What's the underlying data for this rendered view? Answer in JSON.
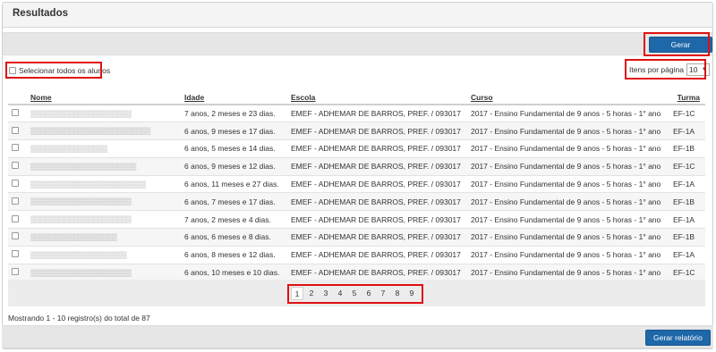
{
  "title": "Resultados",
  "actions": {
    "generate_report": "Gerar relatório"
  },
  "select_all_label": "Selecionar todos os alunos",
  "per_page": {
    "label": "Itens por página",
    "value": "10"
  },
  "table": {
    "headers": {
      "nome": "Nome",
      "idade": "Idade",
      "escola": "Escola",
      "curso": "Curso",
      "turma": "Turma"
    },
    "rows": [
      {
        "nome": "▒▒▒▒▒▒▒▒▒▒▒▒▒▒▒▒▒▒▒▒▒",
        "idade": "7 anos, 2 meses e 23 dias.",
        "escola": "EMEF - ADHEMAR DE BARROS, PREF. / 093017",
        "curso": "2017 - Ensino Fundamental de 9 anos - 5 horas - 1° ano",
        "turma": "EF-1C"
      },
      {
        "nome": "▒▒▒▒▒▒▒▒▒▒▒▒▒▒▒▒▒▒▒▒▒▒▒▒▒",
        "idade": "6 anos, 9 meses e 17 dias.",
        "escola": "EMEF - ADHEMAR DE BARROS, PREF. / 093017",
        "curso": "2017 - Ensino Fundamental de 9 anos - 5 horas - 1° ano",
        "turma": "EF-1A"
      },
      {
        "nome": "▒▒▒▒▒▒▒▒▒▒▒▒▒▒▒▒",
        "idade": "6 anos, 5 meses e 14 dias.",
        "escola": "EMEF - ADHEMAR DE BARROS, PREF. / 093017",
        "curso": "2017 - Ensino Fundamental de 9 anos - 5 horas - 1° ano",
        "turma": "EF-1B"
      },
      {
        "nome": "▒▒▒▒▒▒▒▒▒▒▒▒▒▒▒▒▒▒▒▒▒▒",
        "idade": "6 anos, 9 meses e 12 dias.",
        "escola": "EMEF - ADHEMAR DE BARROS, PREF. / 093017",
        "curso": "2017 - Ensino Fundamental de 9 anos - 5 horas - 1° ano",
        "turma": "EF-1C"
      },
      {
        "nome": "▒▒▒▒▒▒▒▒▒▒▒▒▒▒▒▒▒▒▒▒▒▒▒▒",
        "idade": "6 anos, 11 meses e 27 dias.",
        "escola": "EMEF - ADHEMAR DE BARROS, PREF. / 093017",
        "curso": "2017 - Ensino Fundamental de 9 anos - 5 horas - 1° ano",
        "turma": "EF-1A"
      },
      {
        "nome": "▒▒▒▒▒▒▒▒▒▒▒▒▒▒▒▒▒▒▒▒▒",
        "idade": "6 anos, 7 meses e 17 dias.",
        "escola": "EMEF - ADHEMAR DE BARROS, PREF. / 093017",
        "curso": "2017 - Ensino Fundamental de 9 anos - 5 horas - 1° ano",
        "turma": "EF-1B"
      },
      {
        "nome": "▒▒▒▒▒▒▒▒▒▒▒▒▒▒▒▒▒▒▒▒▒",
        "idade": "7 anos, 2 meses e 4 dias.",
        "escola": "EMEF - ADHEMAR DE BARROS, PREF. / 093017",
        "curso": "2017 - Ensino Fundamental de 9 anos - 5 horas - 1° ano",
        "turma": "EF-1A"
      },
      {
        "nome": "▒▒▒▒▒▒▒▒▒▒▒▒▒▒▒▒▒▒",
        "idade": "6 anos, 6 meses e 8 dias.",
        "escola": "EMEF - ADHEMAR DE BARROS, PREF. / 093017",
        "curso": "2017 - Ensino Fundamental de 9 anos - 5 horas - 1° ano",
        "turma": "EF-1B"
      },
      {
        "nome": "▒▒▒▒▒▒▒▒▒▒▒▒▒▒▒▒▒▒▒▒",
        "idade": "6 anos, 8 meses e 12 dias.",
        "escola": "EMEF - ADHEMAR DE BARROS, PREF. / 093017",
        "curso": "2017 - Ensino Fundamental de 9 anos - 5 horas - 1° ano",
        "turma": "EF-1A"
      },
      {
        "nome": "▒▒▒▒▒▒▒▒▒▒▒▒▒▒▒▒▒▒▒▒▒",
        "idade": "6 anos, 10 meses e 10 dias.",
        "escola": "EMEF - ADHEMAR DE BARROS, PREF. / 093017",
        "curso": "2017 - Ensino Fundamental de 9 anos - 5 horas - 1° ano",
        "turma": "EF-1C"
      }
    ]
  },
  "pagination": {
    "pages": [
      "1",
      "2",
      "3",
      "4",
      "5",
      "6",
      "7",
      "8",
      "9"
    ],
    "active": "1"
  },
  "summary": "Mostrando 1 - 10 registro(s) do total de 87",
  "colors": {
    "primary": "#1e67a8",
    "highlight": "#e01010",
    "toolbar": "#e6e6e6"
  }
}
